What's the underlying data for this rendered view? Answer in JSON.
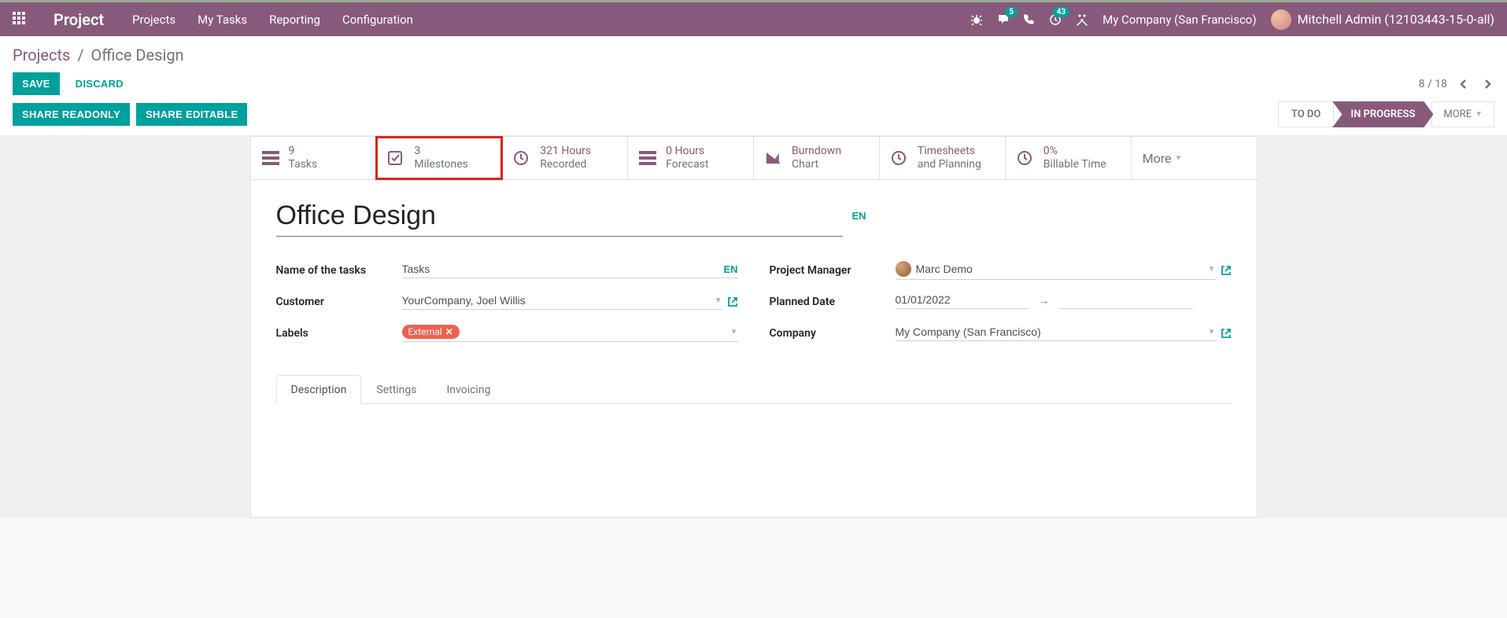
{
  "nav": {
    "brand": "Project",
    "menu": [
      "Projects",
      "My Tasks",
      "Reporting",
      "Configuration"
    ],
    "messaging_badge": "5",
    "activity_badge": "43",
    "company": "My Company (San Francisco)",
    "user": "Mitchell Admin (12103443-15-0-all)"
  },
  "breadcrumb": {
    "root": "Projects",
    "current": "Office Design"
  },
  "actions": {
    "save": "SAVE",
    "discard": "DISCARD",
    "share_ro": "SHARE READONLY",
    "share_rw": "SHARE EDITABLE"
  },
  "pager": {
    "text": "8 / 18"
  },
  "status": {
    "todo": "TO DO",
    "inprogress": "IN PROGRESS",
    "more": "MORE"
  },
  "stats": {
    "tasks": {
      "val": "9",
      "lbl": "Tasks"
    },
    "milestones": {
      "val": "3",
      "lbl": "Milestones"
    },
    "recorded": {
      "val": "321 Hours",
      "lbl": "Recorded"
    },
    "forecast": {
      "val": "0 Hours",
      "lbl": "Forecast"
    },
    "burndown": {
      "val": "Burndown",
      "lbl": "Chart"
    },
    "timesheets": {
      "val": "Timesheets",
      "lbl": "and Planning"
    },
    "billable": {
      "val": "0%",
      "lbl": "Billable Time"
    },
    "more": "More"
  },
  "form": {
    "title": "Office Design",
    "lang": "EN",
    "labels": {
      "task_name": "Name of the tasks",
      "customer": "Customer",
      "labels": "Labels",
      "pm": "Project Manager",
      "planned": "Planned Date",
      "company": "Company"
    },
    "values": {
      "task_name": "Tasks",
      "customer": "YourCompany, Joel Willis",
      "label_tag": "External",
      "pm": "Marc Demo",
      "planned_from": "01/01/2022",
      "company": "My Company (San Francisco)"
    }
  },
  "tabs": [
    "Description",
    "Settings",
    "Invoicing"
  ]
}
